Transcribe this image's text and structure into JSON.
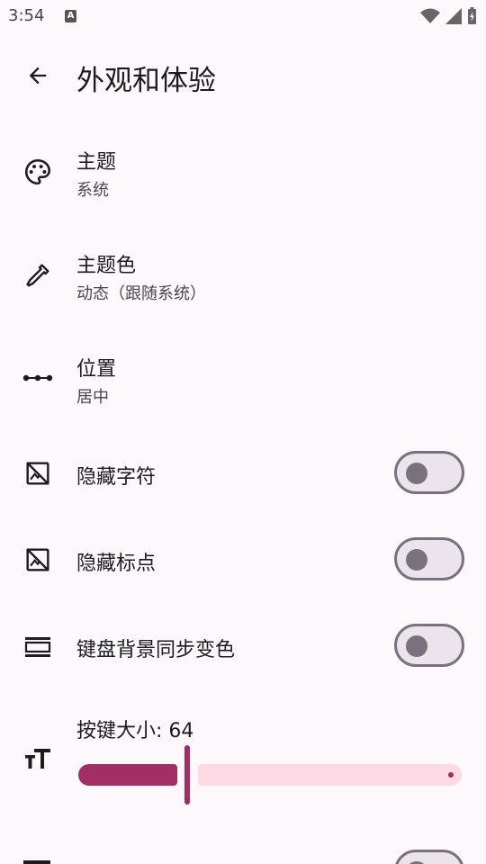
{
  "status_bar": {
    "time": "3:54",
    "notification_glyph": "A"
  },
  "app_bar": {
    "title": "外观和体验"
  },
  "settings": [
    {
      "title": "主题",
      "subtitle": "系统",
      "icon": "palette-icon"
    },
    {
      "title": "主题色",
      "subtitle": "动态（跟随系统）",
      "icon": "eyedropper-icon"
    },
    {
      "title": "位置",
      "subtitle": "居中",
      "icon": "position-dots-icon"
    },
    {
      "title": "隐藏字符",
      "icon": "hide-image-icon",
      "toggle": false
    },
    {
      "title": "隐藏标点",
      "icon": "hide-image-icon",
      "toggle": false
    },
    {
      "title": "键盘背景同步变色",
      "icon": "keyboard-background-icon",
      "toggle": false
    }
  ],
  "key_size": {
    "label": "按键大小: 64",
    "icon": "text-size-icon",
    "value": 64,
    "fill_fraction": 0.26
  },
  "colors": {
    "accent": "#a22e63",
    "accent_light": "#fdd9e3",
    "background": "#fcf8fc",
    "outline": "#7a717d"
  }
}
